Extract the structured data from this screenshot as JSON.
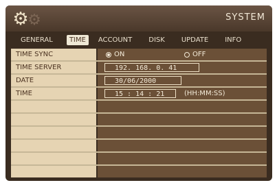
{
  "header": {
    "title": "SYSTEM",
    "icon": "gear-icon"
  },
  "tabs": [
    {
      "label": "GENERAL",
      "active": false
    },
    {
      "label": "TIME",
      "active": true
    },
    {
      "label": "ACCOUNT",
      "active": false
    },
    {
      "label": "DISK",
      "active": false
    },
    {
      "label": "UPDATE",
      "active": false
    },
    {
      "label": "INFO",
      "active": false
    }
  ],
  "settings": {
    "time_sync": {
      "label": "TIME SYNC",
      "on_label": "ON",
      "off_label": "OFF",
      "selected": "ON"
    },
    "time_server": {
      "label": "TIME SERVER",
      "value": "192. 168.   0. 41"
    },
    "date": {
      "label": "DATE",
      "value": "30/06/2000"
    },
    "time": {
      "label": "TIME",
      "value": "15 : 14 : 21",
      "format": "(HH:MM:SS)"
    }
  },
  "colors": {
    "background": "#3a2c20",
    "label_cell": "#e6d4b3",
    "value_cell": "#6b5037",
    "active_tab": "#efe8d5"
  }
}
